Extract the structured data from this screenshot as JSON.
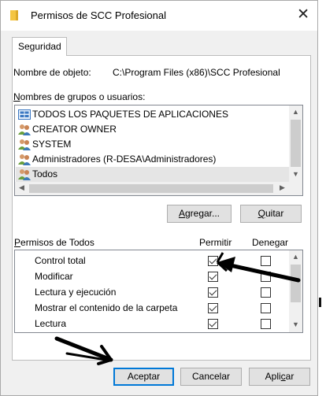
{
  "window": {
    "title": "Permisos de SCC Profesional",
    "close": "✕"
  },
  "tab": {
    "label": "Seguridad"
  },
  "object": {
    "label": "Nombre de objeto:",
    "value": "C:\\Program Files (x86)\\SCC Profesional"
  },
  "groups": {
    "label_key": "N",
    "label_rest": "ombres de grupos o usuarios:",
    "items": [
      {
        "label": "TODOS LOS PAQUETES DE APLICACIONES",
        "icon": "app-packages-icon"
      },
      {
        "label": "CREATOR OWNER",
        "icon": "users-icon"
      },
      {
        "label": "SYSTEM",
        "icon": "users-icon"
      },
      {
        "label": "Administradores (R-DESA\\Administradores)",
        "icon": "users-icon"
      },
      {
        "label": "Todos",
        "icon": "users-icon",
        "selected": true
      }
    ]
  },
  "buttons": {
    "add_key": "A",
    "add_rest": "gregar...",
    "remove_key": "Q",
    "remove_rest": "uitar",
    "accept": "Aceptar",
    "cancel": "Cancelar",
    "apply_pre": "Apli",
    "apply_key": "c",
    "apply_post": "ar"
  },
  "permissions": {
    "title_key": "P",
    "title_rest": "ermisos de Todos",
    "allow_header": "Permitir",
    "deny_header": "Denegar",
    "rows": [
      {
        "name": "Control total",
        "allow": true,
        "deny": false
      },
      {
        "name": "Modificar",
        "allow": true,
        "deny": false
      },
      {
        "name": "Lectura y ejecución",
        "allow": true,
        "deny": false
      },
      {
        "name": "Mostrar el contenido de la carpeta",
        "allow": true,
        "deny": false
      },
      {
        "name": "Lectura",
        "allow": true,
        "deny": false
      }
    ]
  },
  "colors": {
    "accent": "#0078d7",
    "folder": "#f4c542"
  }
}
